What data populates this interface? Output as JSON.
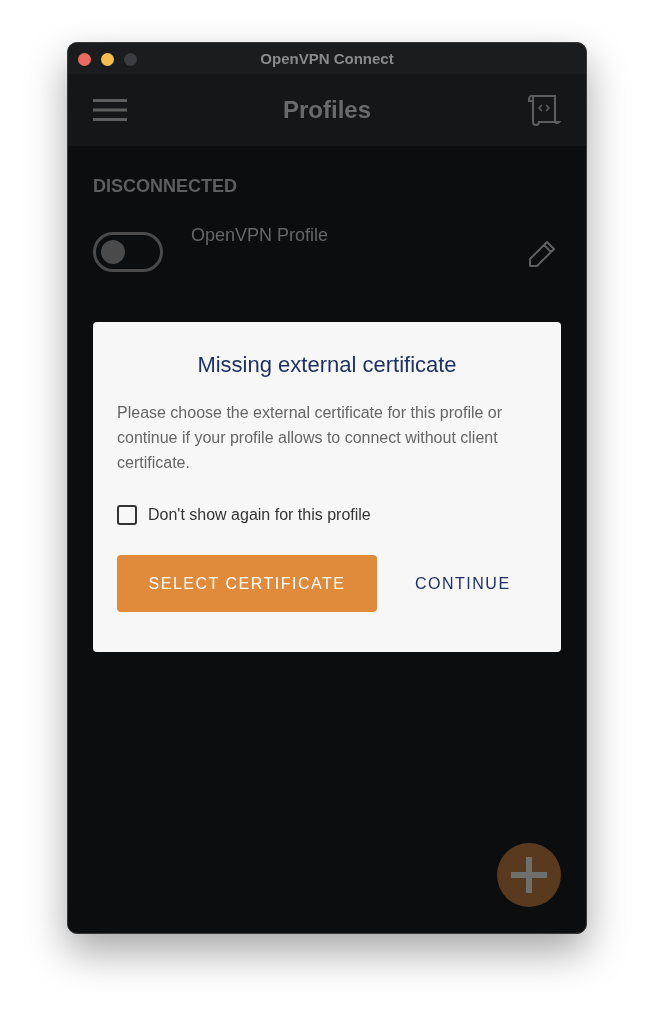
{
  "window": {
    "title": "OpenVPN Connect"
  },
  "header": {
    "title": "Profiles"
  },
  "section_label": "DISCONNECTED",
  "profiles": [
    {
      "name": "OpenVPN Profile",
      "on": false
    }
  ],
  "dialog": {
    "title": "Missing external certificate",
    "message": "Please choose the external certificate for this profile or continue if your profile allows to connect without client certificate.",
    "checkbox": {
      "label": "Don't show again for this profile",
      "checked": false
    },
    "buttons": [
      {
        "label": "SELECT CERTIFICATE",
        "kind": "primary"
      },
      {
        "label": "CONTINUE",
        "kind": "text"
      }
    ]
  }
}
